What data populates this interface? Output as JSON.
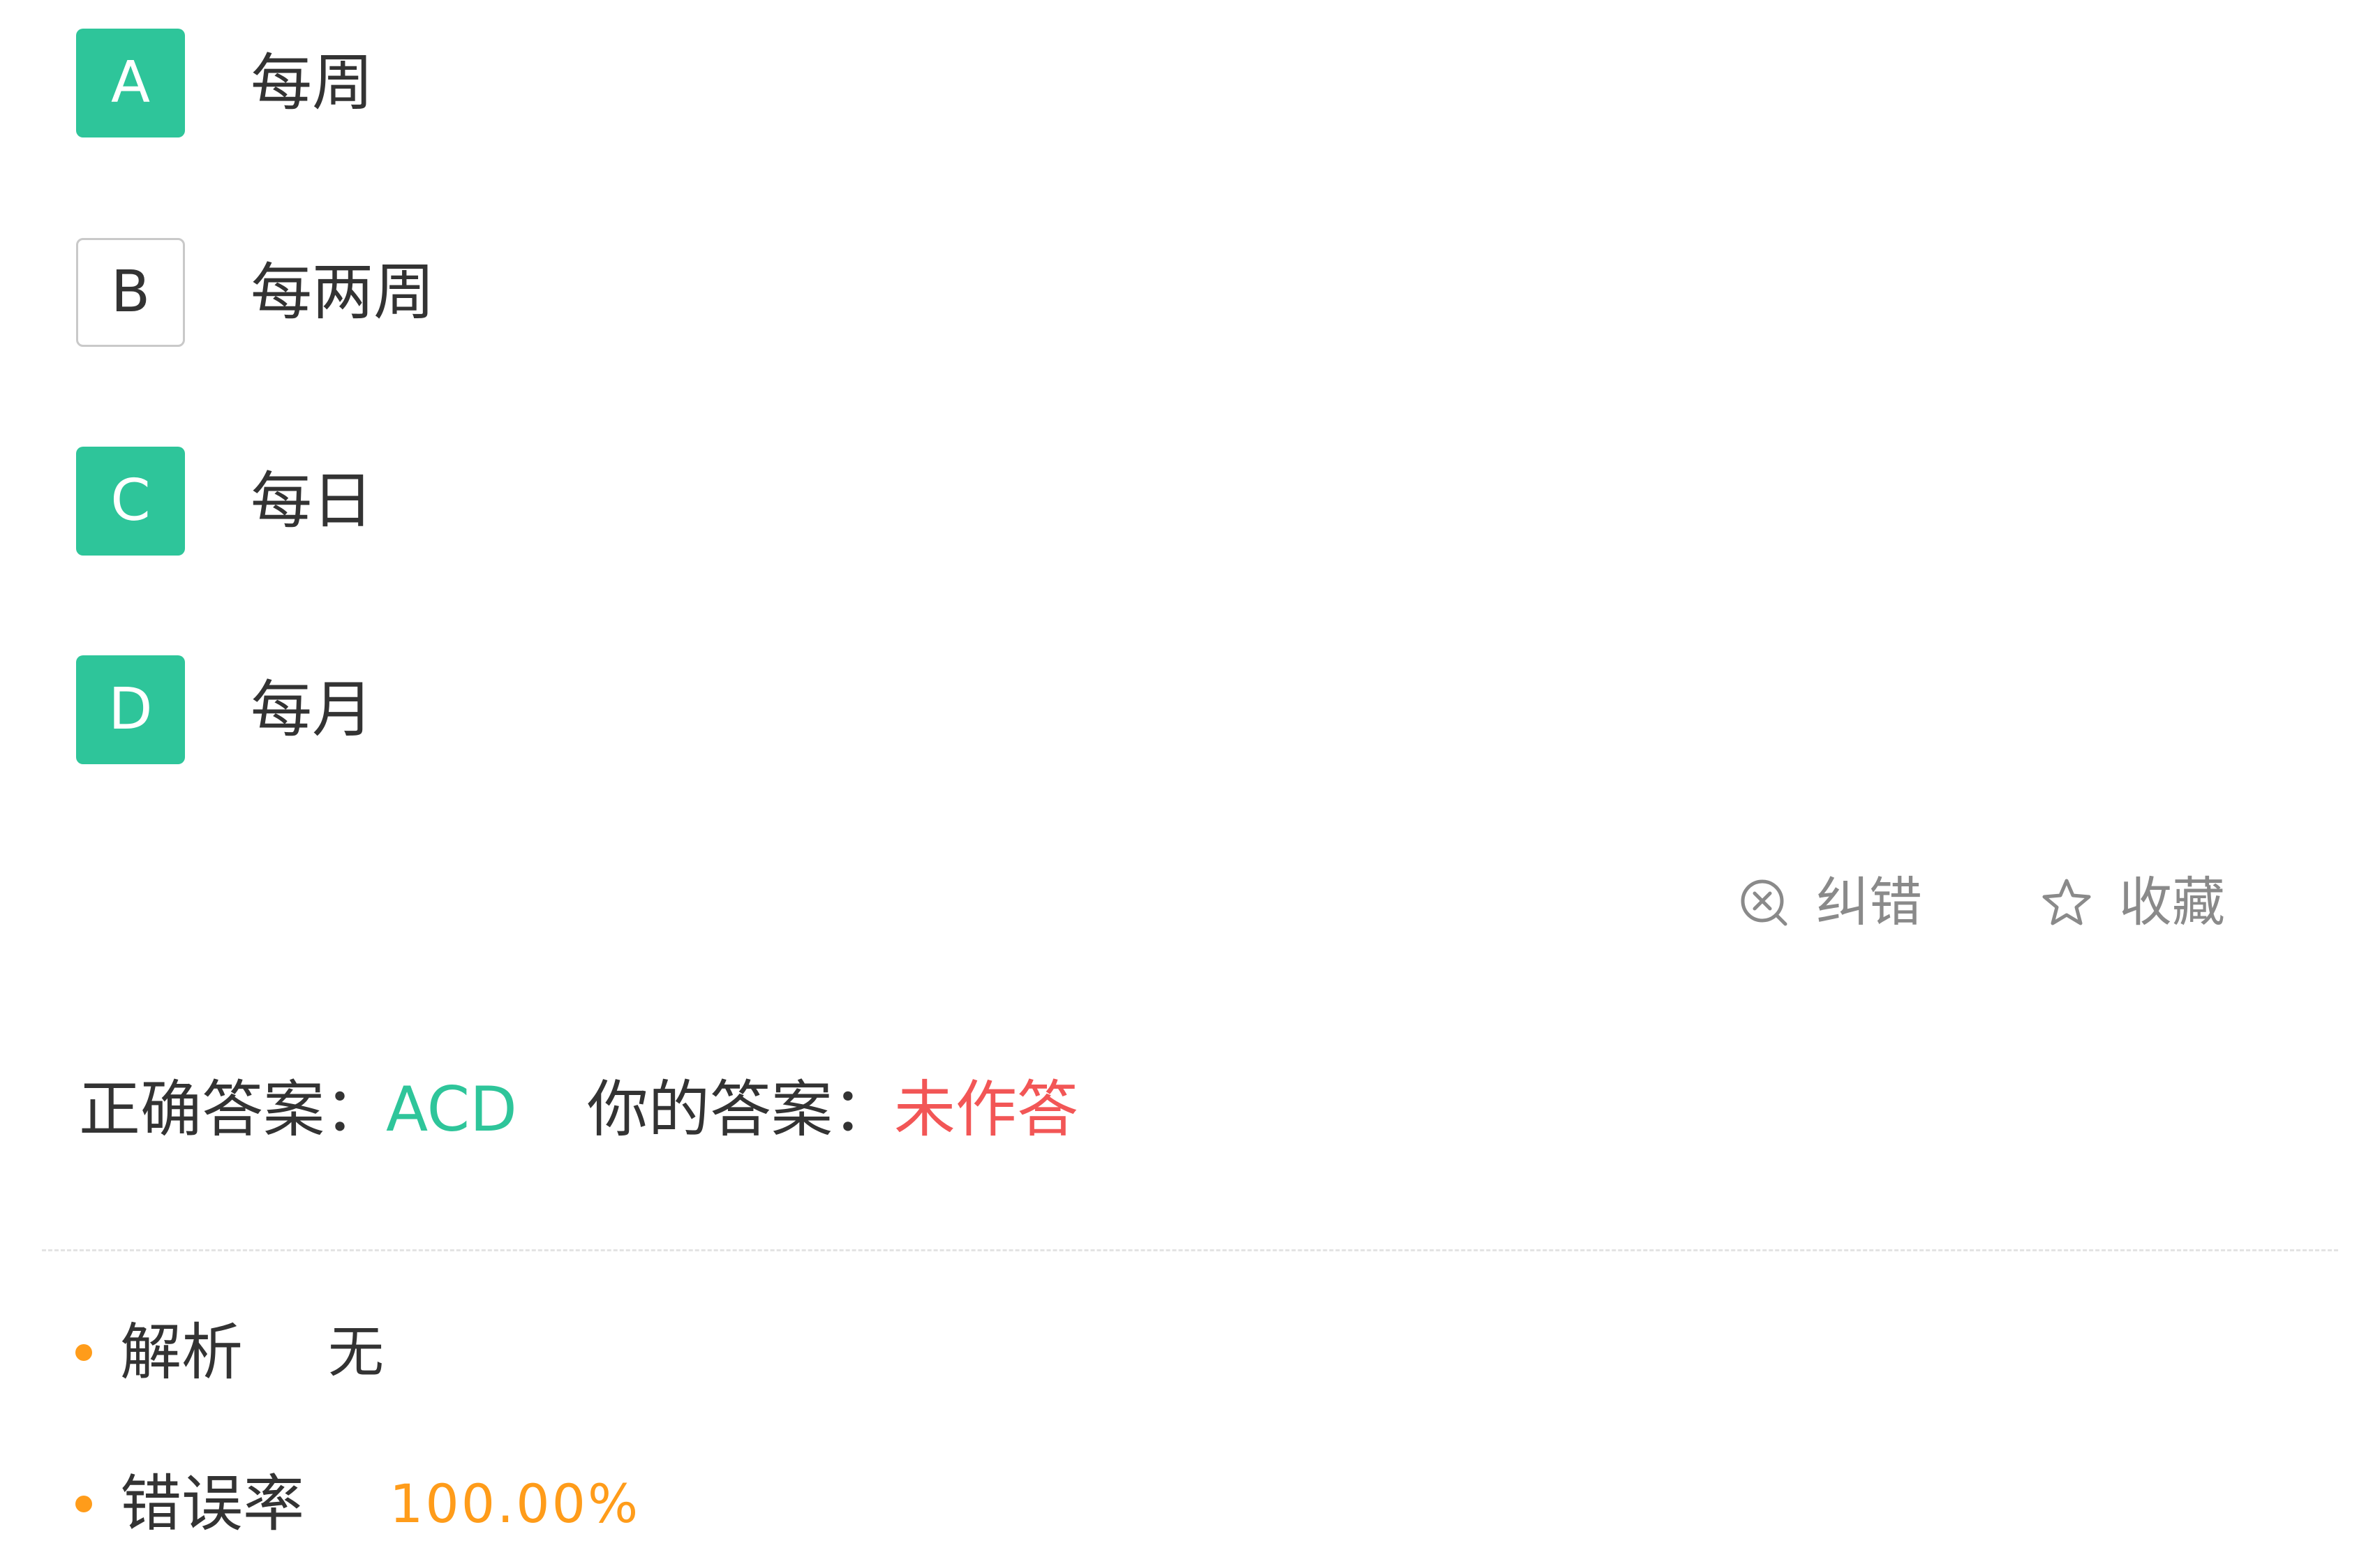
{
  "options": [
    {
      "letter": "A",
      "text": "每周",
      "selected": true
    },
    {
      "letter": "B",
      "text": "每两周",
      "selected": false
    },
    {
      "letter": "C",
      "text": "每日",
      "selected": true
    },
    {
      "letter": "D",
      "text": "每月",
      "selected": true
    }
  ],
  "actions": {
    "report_label": "纠错",
    "report_icon": "circle-x-icon",
    "favorite_label": "收藏",
    "favorite_icon": "star-outline-icon"
  },
  "answer": {
    "correct_label": "正确答案：",
    "correct_value": "ACD",
    "mine_label": "你的答案：",
    "mine_value": "未作答"
  },
  "analysis": {
    "label": "解析",
    "value": "无"
  },
  "error_rate": {
    "label": "错误率",
    "value": "100.00%"
  },
  "colors": {
    "selected": "#2ec59a",
    "unselected_border": "#c9c9c9",
    "correct": "#2ec59a",
    "unanswered": "#f25656",
    "accent_orange": "#ff9c1a",
    "muted": "#8a8a8a"
  }
}
